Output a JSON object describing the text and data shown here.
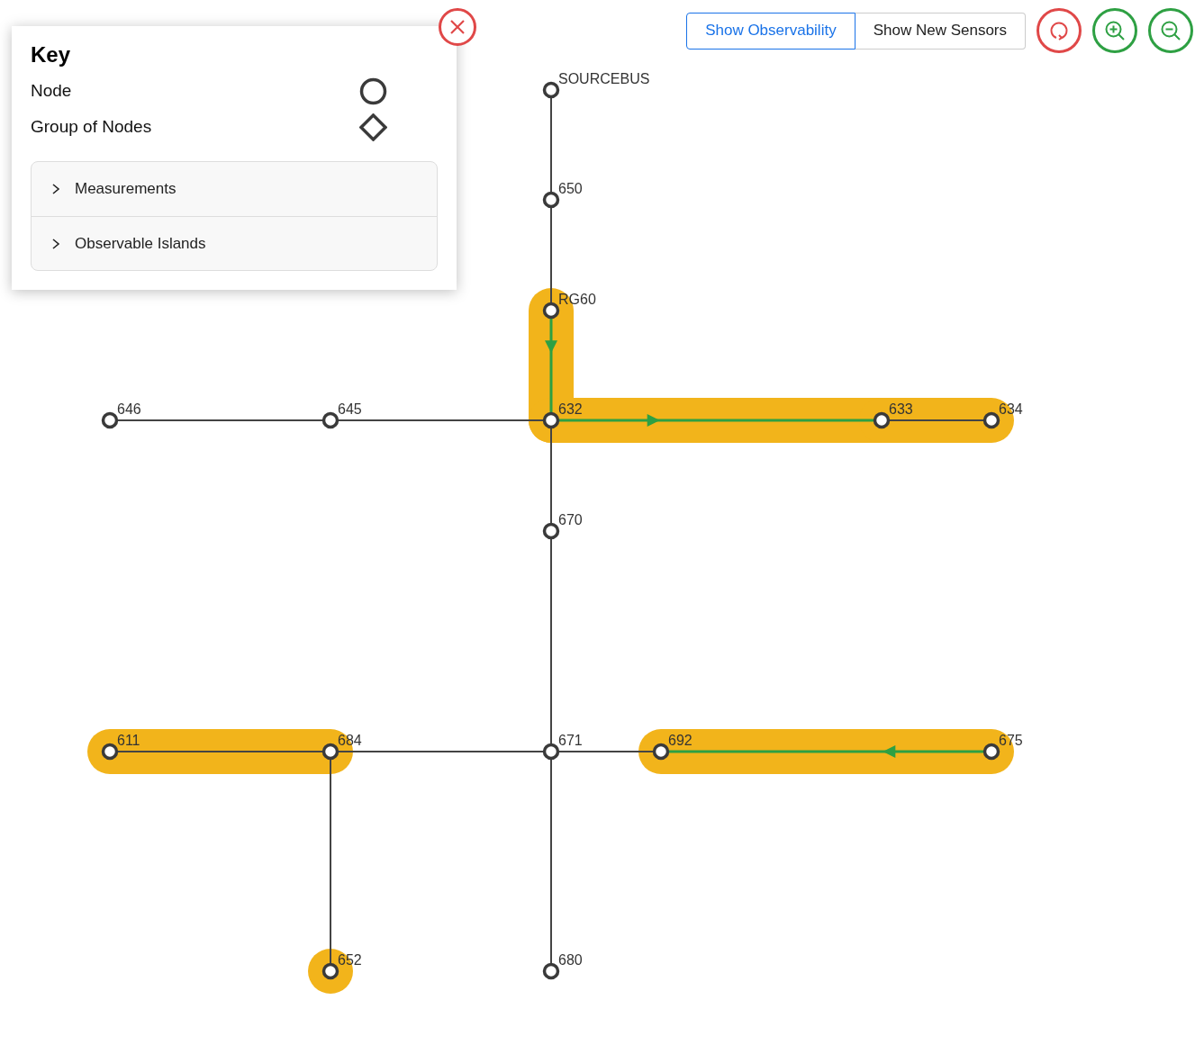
{
  "key_panel": {
    "title": "Key",
    "legend": [
      {
        "label": "Node",
        "kind": "node"
      },
      {
        "label": "Group of Nodes",
        "kind": "group"
      }
    ],
    "sections": [
      {
        "label": "Measurements",
        "expanded": false
      },
      {
        "label": "Observable Islands",
        "expanded": false
      }
    ]
  },
  "view_toggle": [
    {
      "label": "Show Observability",
      "selected": true
    },
    {
      "label": "Show New Sensors",
      "selected": false
    }
  ],
  "nodes": [
    {
      "label": "SOURCEBUS",
      "highlighted": false
    },
    {
      "label": "650",
      "highlighted": false
    },
    {
      "label": "RG60",
      "highlighted": false
    },
    {
      "label": "646",
      "highlighted": false
    },
    {
      "label": "645",
      "highlighted": false
    },
    {
      "label": "632",
      "highlighted": false
    },
    {
      "label": "633",
      "highlighted": false
    },
    {
      "label": "634",
      "highlighted": false
    },
    {
      "label": "670",
      "highlighted": false
    },
    {
      "label": "611",
      "highlighted": false
    },
    {
      "label": "684",
      "highlighted": false
    },
    {
      "label": "671",
      "highlighted": false
    },
    {
      "label": "692",
      "highlighted": false
    },
    {
      "label": "675",
      "highlighted": false
    },
    {
      "label": "652",
      "highlighted": true
    },
    {
      "label": "680",
      "highlighted": false
    }
  ],
  "lines": [
    {
      "highlighted": false,
      "measured": false
    },
    {
      "highlighted": false,
      "measured": false
    },
    {
      "highlighted": true,
      "measured": true
    },
    {
      "highlighted": false,
      "measured": false
    },
    {
      "highlighted": false,
      "measured": false
    },
    {
      "highlighted": true,
      "measured": true
    },
    {
      "highlighted": true,
      "measured": false
    },
    {
      "highlighted": false,
      "measured": false
    },
    {
      "highlighted": false,
      "measured": false
    },
    {
      "highlighted": true,
      "measured": false
    },
    {
      "highlighted": false,
      "measured": false
    },
    {
      "highlighted": false,
      "measured": false
    },
    {
      "highlighted": true,
      "measured": true
    },
    {
      "highlighted": false,
      "measured": false
    },
    {
      "highlighted": false,
      "measured": false
    }
  ]
}
